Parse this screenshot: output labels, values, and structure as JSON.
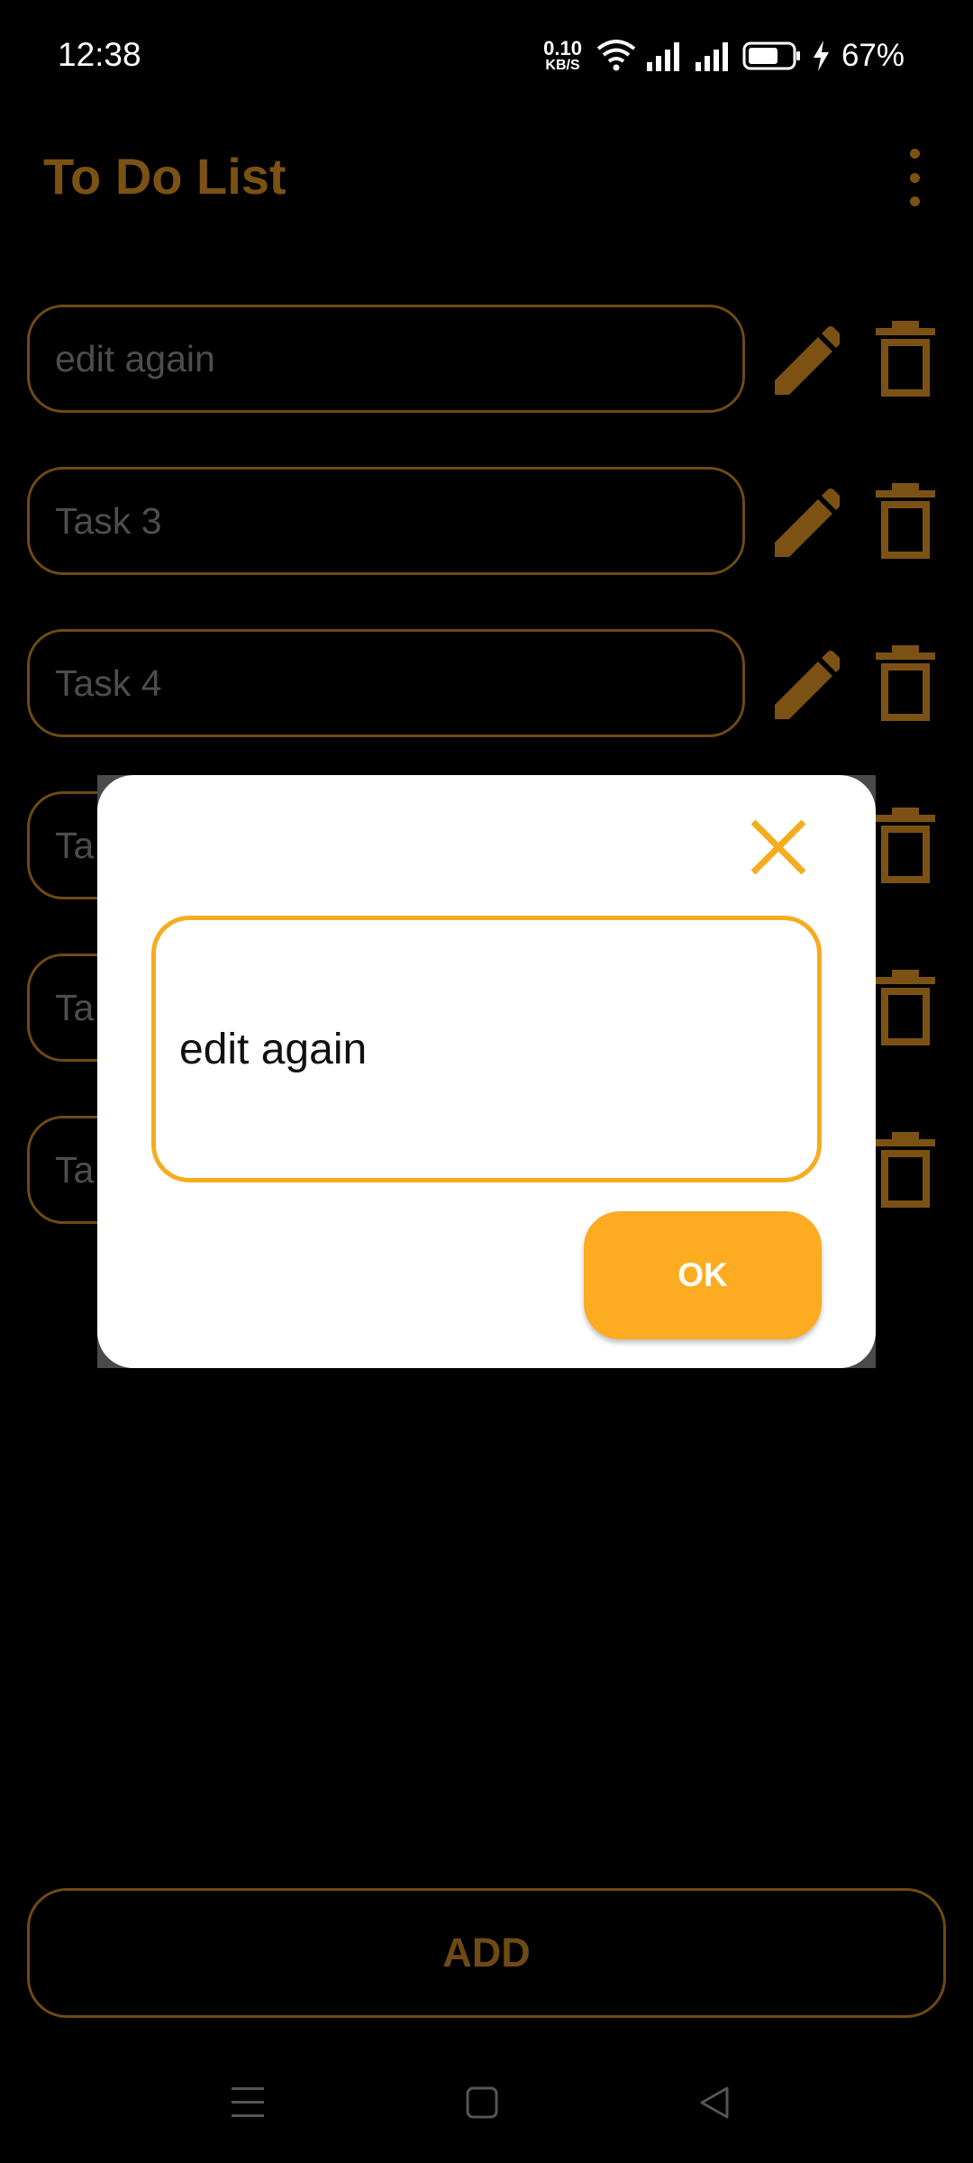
{
  "status_bar": {
    "time": "12:38",
    "net_speed_value": "0.10",
    "net_speed_unit": "KB/S",
    "battery_percent": "67%"
  },
  "app": {
    "title": "To Do List",
    "tasks": [
      {
        "label": "edit again"
      },
      {
        "label": "Task 3"
      },
      {
        "label": "Task 4"
      },
      {
        "label": "Ta"
      },
      {
        "label": "Ta"
      },
      {
        "label": "Ta"
      }
    ],
    "add_label": "ADD"
  },
  "dialog": {
    "input_value": "edit again",
    "ok_label": "OK"
  },
  "icons": {
    "overflow": "more-vertical-icon",
    "edit": "pencil-icon",
    "delete": "trash-icon",
    "close": "close-icon",
    "nav_menu": "menu-icon",
    "nav_home": "home-square-icon",
    "nav_back": "back-triangle-icon"
  },
  "colors": {
    "accent": "#fdab20",
    "accent_dimmed": "#7b5214",
    "background": "#000000",
    "dialog_bg": "#ffffff"
  }
}
